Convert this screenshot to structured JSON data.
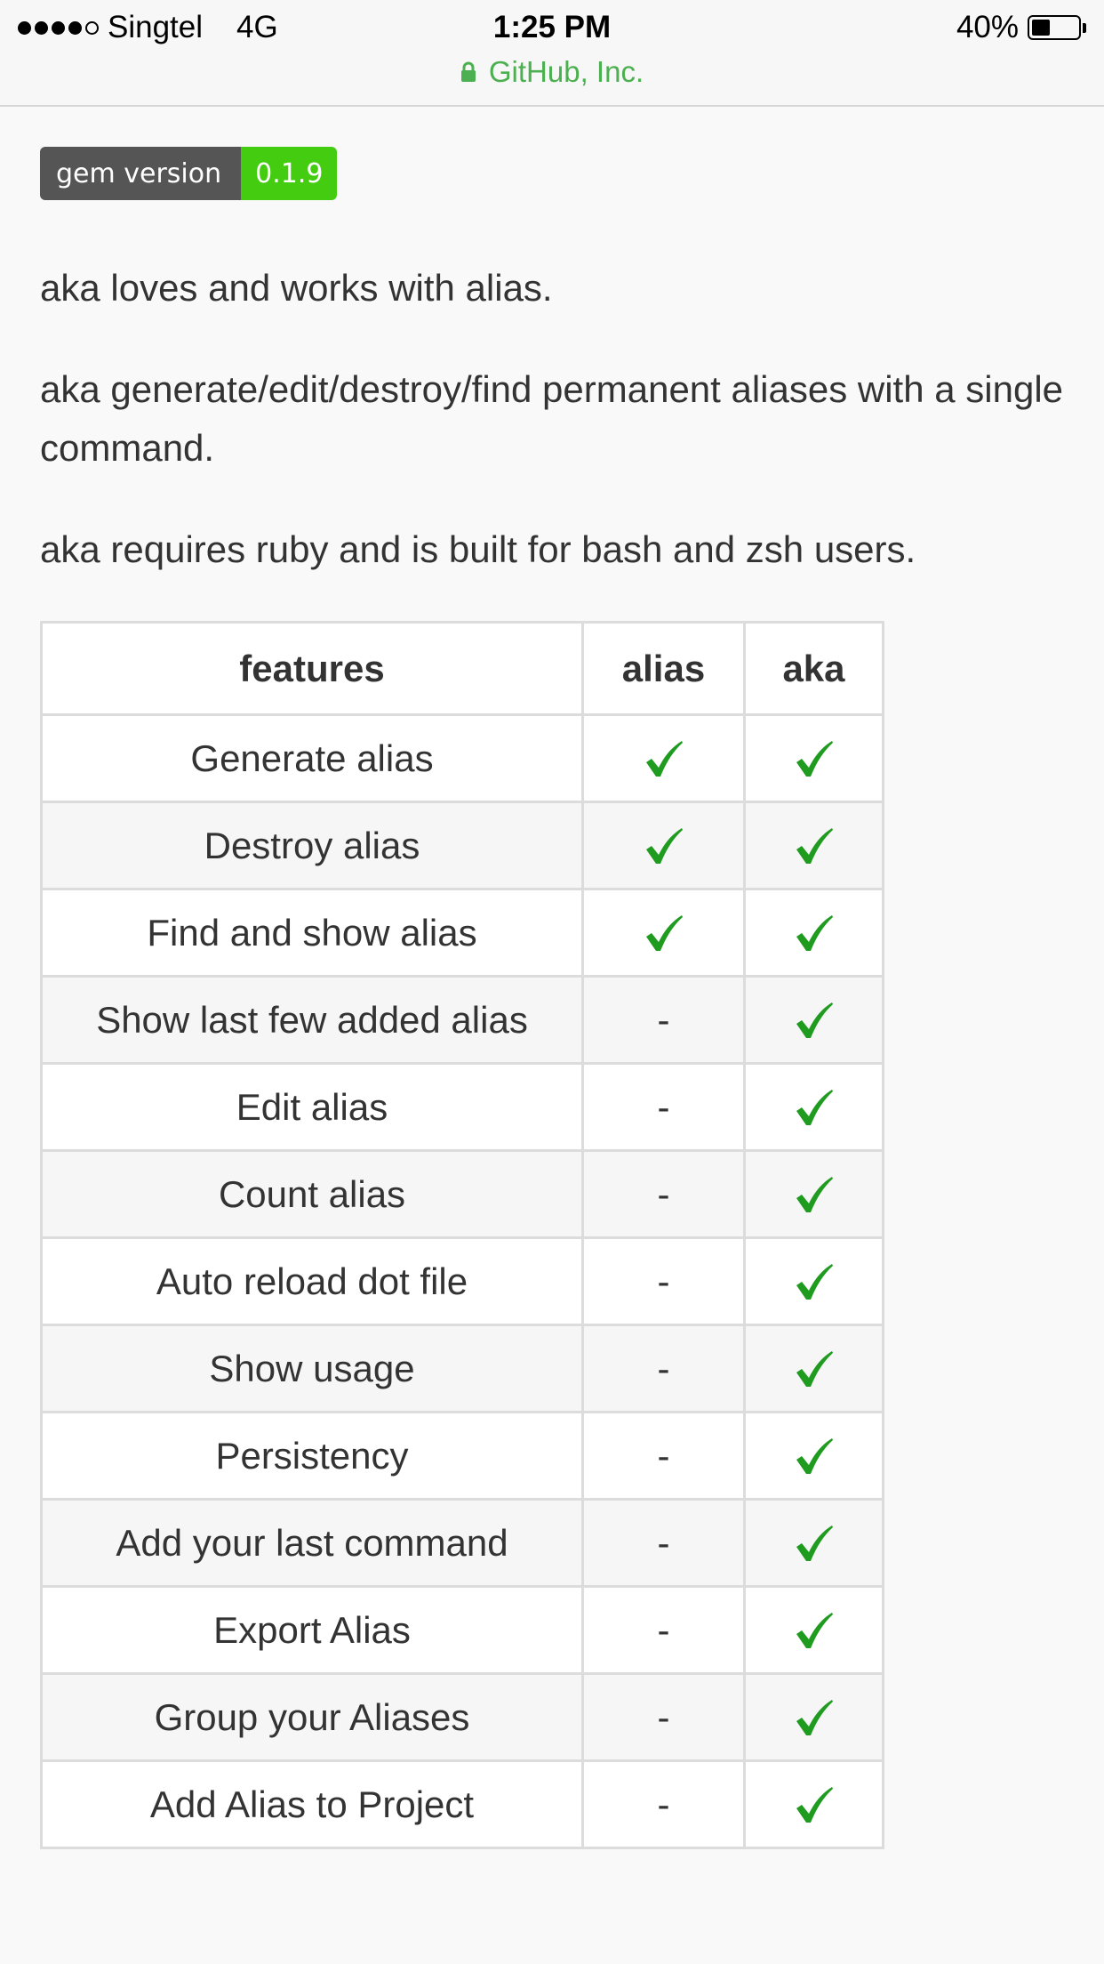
{
  "status_bar": {
    "carrier": "Singtel",
    "network": "4G",
    "time": "1:25 PM",
    "battery_percent": "40%",
    "battery_level": 0.4,
    "signal_bars_filled": 4,
    "signal_bars_total": 5,
    "site_name": "GitHub, Inc."
  },
  "badge": {
    "label": "gem version",
    "value": "0.1.9",
    "label_color": "#555555",
    "value_color": "#44cc11"
  },
  "paragraphs": [
    "aka loves and works with alias.",
    "aka generate/edit/destroy/find permanent aliases with a single command.",
    "aka requires ruby and is built for bash and zsh users."
  ],
  "table": {
    "headers": [
      "features",
      "alias",
      "aka"
    ],
    "check_color": "#1f9b1f",
    "rows": [
      {
        "feature": "Generate alias",
        "alias": "check",
        "aka": "check"
      },
      {
        "feature": "Destroy alias",
        "alias": "check",
        "aka": "check"
      },
      {
        "feature": "Find and show alias",
        "alias": "check",
        "aka": "check"
      },
      {
        "feature": "Show last few added alias",
        "alias": "-",
        "aka": "check"
      },
      {
        "feature": "Edit alias",
        "alias": "-",
        "aka": "check"
      },
      {
        "feature": "Count alias",
        "alias": "-",
        "aka": "check"
      },
      {
        "feature": "Auto reload dot file",
        "alias": "-",
        "aka": "check"
      },
      {
        "feature": "Show usage",
        "alias": "-",
        "aka": "check"
      },
      {
        "feature": "Persistency",
        "alias": "-",
        "aka": "check"
      },
      {
        "feature": "Add your last command",
        "alias": "-",
        "aka": "check"
      },
      {
        "feature": "Export Alias",
        "alias": "-",
        "aka": "check"
      },
      {
        "feature": "Group your Aliases",
        "alias": "-",
        "aka": "check"
      },
      {
        "feature": "Add Alias to Project",
        "alias": "-",
        "aka": "check"
      }
    ]
  }
}
